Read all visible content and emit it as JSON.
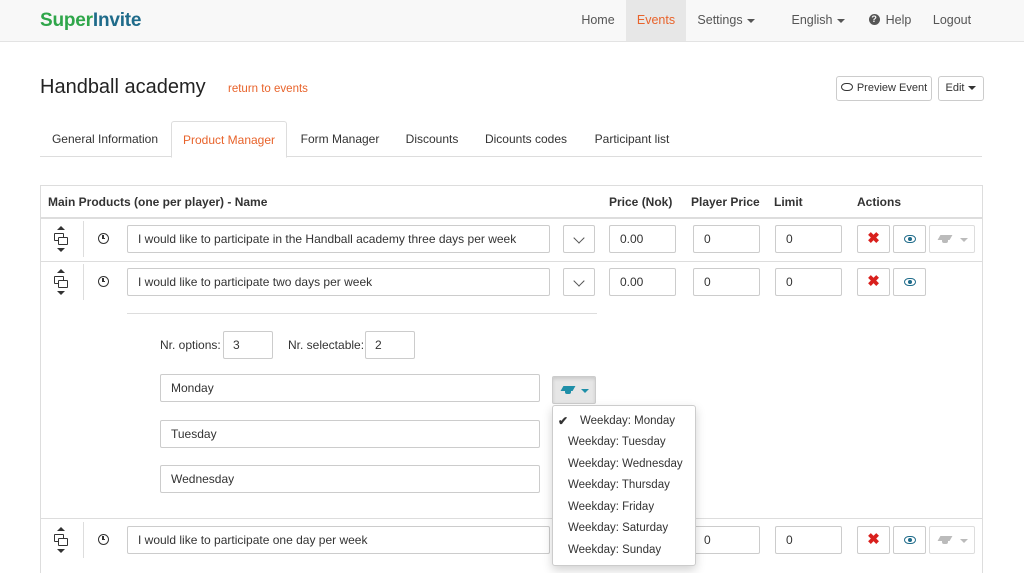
{
  "brand": {
    "part1": "Super",
    "part2": "Invite"
  },
  "nav": {
    "home": "Home",
    "events": "Events",
    "settings": "Settings",
    "language": "English",
    "help_icon": "question-circle-icon",
    "help": "Help",
    "logout": "Logout"
  },
  "page": {
    "title": "Handball academy",
    "return_link": "return to events",
    "preview_button": "Preview Event",
    "edit_button": "Edit"
  },
  "tabs": [
    {
      "label": "General Information",
      "active": false
    },
    {
      "label": "Product Manager",
      "active": true
    },
    {
      "label": "Form Manager",
      "active": false
    },
    {
      "label": "Discounts",
      "active": false
    },
    {
      "label": "Dicounts codes",
      "active": false
    },
    {
      "label": "Participant list",
      "active": false
    }
  ],
  "table": {
    "headers": {
      "name": "Main Products (one per player) - Name",
      "price": "Price (Nok)",
      "player_price": "Player Price",
      "limit": "Limit",
      "actions": "Actions"
    },
    "rows": [
      {
        "name": "I would like to participate in the Handball academy three days per week",
        "price": "0.00",
        "player_price": "0",
        "limit": "0"
      },
      {
        "name": "I would like to participate two days per week",
        "price": "0.00",
        "player_price": "0",
        "limit": "0"
      },
      {
        "name": "I would like to participate one day per week",
        "price": "",
        "player_price": "0",
        "limit": "0"
      }
    ]
  },
  "options_panel": {
    "nr_options_label": "Nr. options:",
    "nr_options_value": "3",
    "nr_selectable_label": "Nr. selectable:",
    "nr_selectable_value": "2",
    "options": [
      "Monday",
      "Tuesday",
      "Wednesday"
    ]
  },
  "weekday_dropdown": {
    "items": [
      {
        "label": "Weekday: Monday",
        "checked": true
      },
      {
        "label": "Weekday: Tuesday",
        "checked": false
      },
      {
        "label": "Weekday: Wednesday",
        "checked": false
      },
      {
        "label": "Weekday: Thursday",
        "checked": false
      },
      {
        "label": "Weekday: Friday",
        "checked": false
      },
      {
        "label": "Weekday: Saturday",
        "checked": false
      },
      {
        "label": "Weekday: Sunday",
        "checked": false
      }
    ]
  },
  "colors": {
    "accent": "#e8632b",
    "brand_green": "#2fa64a",
    "brand_blue": "#1f6b8a",
    "delete_red": "#d9201d"
  }
}
